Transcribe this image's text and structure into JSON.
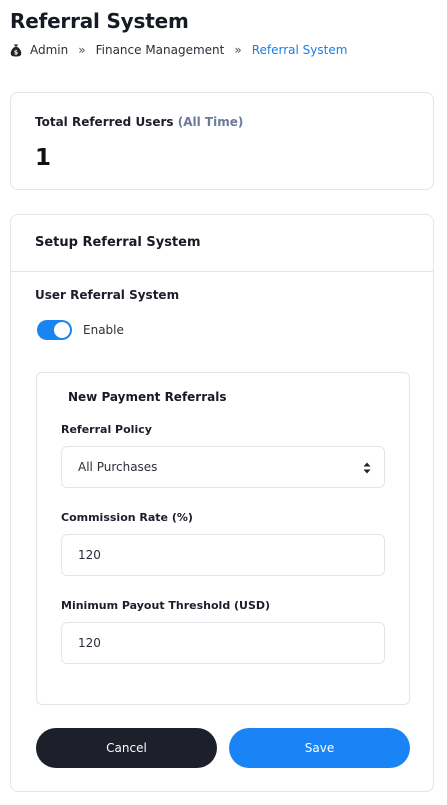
{
  "page": {
    "title": "Referral System"
  },
  "breadcrumb": {
    "icon": "money-bag-icon",
    "items": [
      "Admin",
      "Finance Management",
      "Referral System"
    ],
    "separator": "»",
    "active_color": "#1a7ee6"
  },
  "stats": {
    "label": "Total Referred Users",
    "label_suffix": "(All Time)",
    "value": "1"
  },
  "setup": {
    "title": "Setup Referral System",
    "user_referral_label": "User Referral System",
    "toggle": {
      "label": "Enable",
      "checked": true,
      "color": "#1a84f0"
    },
    "new_payment": {
      "title": "New Payment Referrals",
      "policy_label": "Referral Policy",
      "policy_value": "All Purchases",
      "commission_label": "Commission Rate (%)",
      "commission_value": "120",
      "payout_label": "Minimum Payout Threshold (USD)",
      "payout_value": "120"
    },
    "buttons": {
      "cancel": "Cancel",
      "save": "Save",
      "cancel_color": "#1d1f2b",
      "save_color": "#1a84f7"
    }
  }
}
